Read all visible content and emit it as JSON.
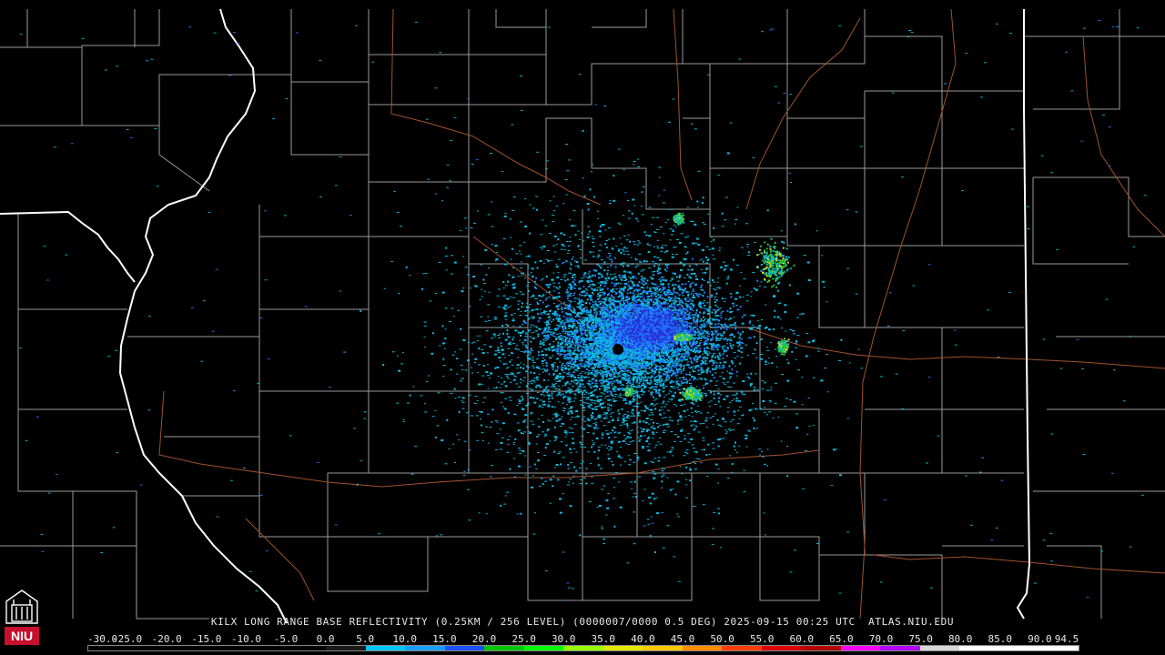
{
  "product_title": "KILX LONG RANGE BASE REFLECTIVITY (0.25KM / 256 LEVEL) (0000007/0000 0.5 DEG) 2025-09-15 00:25 UTC  ATLAS.NIU.EDU",
  "logo": {
    "text": "NIU",
    "color": "#c8102e",
    "icon": "tower-shield-icon"
  },
  "radar_site": "KILX",
  "colorbar": {
    "labels": [
      "-30.0",
      "-25.0",
      "-20.0",
      "-15.0",
      "-10.0",
      "-5.0",
      "0.0",
      "5.0",
      "10.0",
      "15.0",
      "20.0",
      "25.0",
      "30.0",
      "35.0",
      "40.0",
      "45.0",
      "50.0",
      "55.0",
      "60.0",
      "65.0",
      "70.0",
      "75.0",
      "80.0",
      "85.0",
      "90.0",
      "94.5"
    ],
    "colors": [
      "#000000",
      "#000000",
      "#000000",
      "#000000",
      "#000000",
      "#000000",
      "#1a1a1a",
      "#00c8ff",
      "#19a0ff",
      "#1e50ff",
      "#00c800",
      "#00ff00",
      "#96ff00",
      "#e6e600",
      "#ffc800",
      "#ff8c00",
      "#ff3c00",
      "#dc0000",
      "#b40000",
      "#ff00ff",
      "#b400ff",
      "#d8d8d8",
      "#ffffff",
      "#ffffff",
      "#ffffff"
    ]
  },
  "map_colors": {
    "background": "#000000",
    "state_border": "#ffffff",
    "county_border": "#9a9a9a",
    "highway": "#a0522d",
    "echo_light": "#10b8e0",
    "echo_mid": "#1e78ff",
    "echo_core": "#2830d8",
    "echo_green": "#20c040",
    "echo_yellow": "#c8d820"
  }
}
